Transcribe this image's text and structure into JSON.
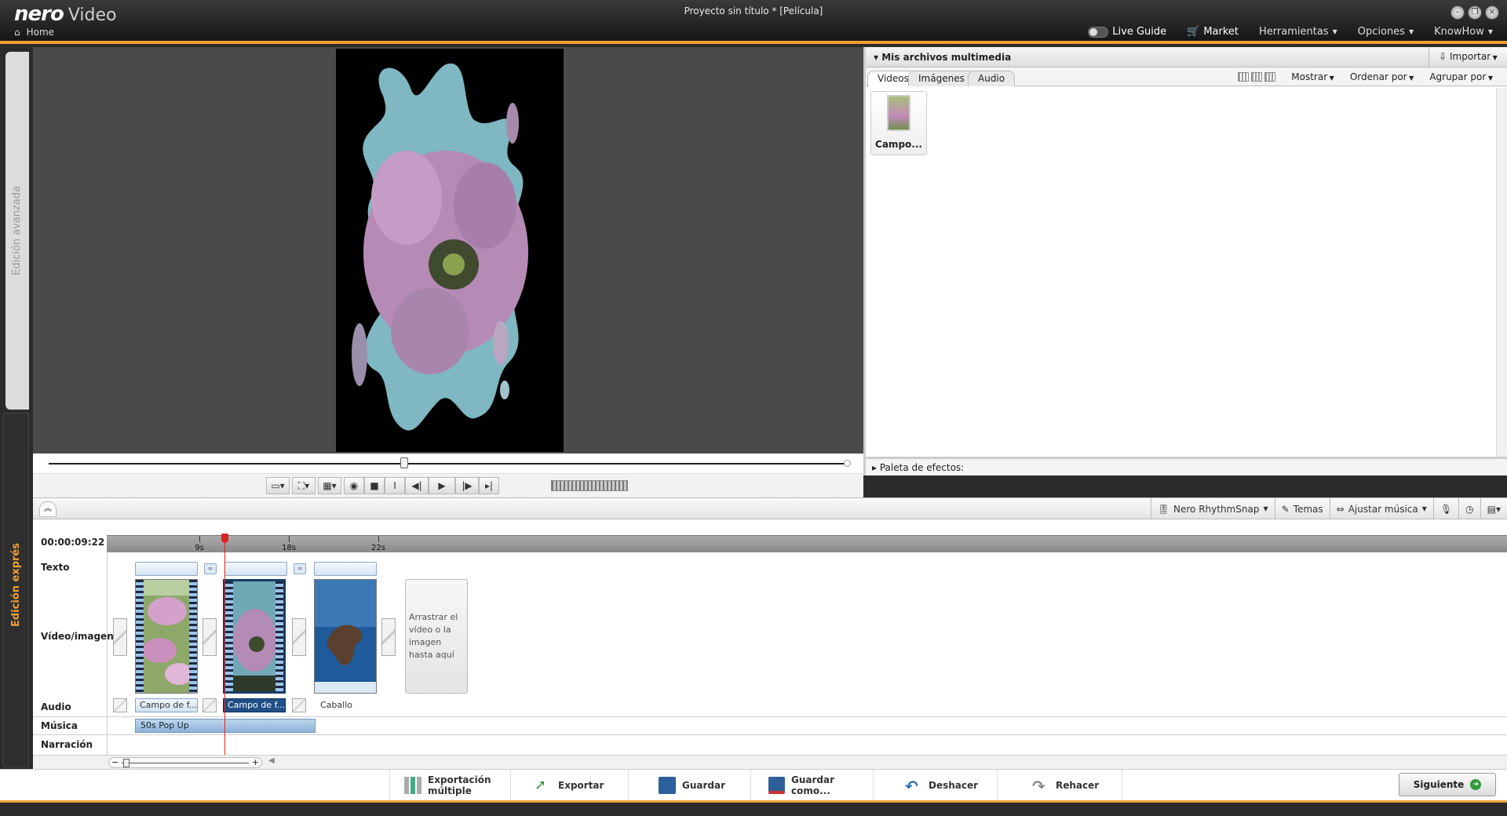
{
  "app": {
    "logo": "nero",
    "logo_sub": "Video",
    "doc_title": "Proyecto sin título * [Película]",
    "home": "Home"
  },
  "menu": {
    "live_guide": "Live Guide",
    "market": "Market",
    "herramientas": "Herramientas",
    "opciones": "Opciones",
    "knowhow": "KnowHow"
  },
  "side_tabs": {
    "advanced": "Edición avanzada",
    "express": "Edición exprés"
  },
  "library": {
    "title": "Mis archivos multimedia",
    "import": "Importar",
    "tabs": [
      "Videos",
      "Imágenes",
      "Audio"
    ],
    "mostrar": "Mostrar",
    "ordenar": "Ordenar por",
    "agrupar": "Agrupar por",
    "items": [
      {
        "label": "Campo..."
      }
    ],
    "effects": "Paleta de efectos:"
  },
  "timeline_toolbar": {
    "rhythmsnap": "Nero RhythmSnap",
    "temas": "Temas",
    "ajustar": "Ajustar música"
  },
  "timeline": {
    "timecode": "00:00:09:22",
    "ticks": [
      "9s",
      "18s",
      "22s"
    ],
    "tracks": {
      "texto": "Texto",
      "video": "Vídeo/imagen",
      "audio": "Audio",
      "musica": "Música",
      "narracion": "Narración"
    },
    "drop_hint": "Arrastrar el vídeo o la imagen hasta aquí",
    "audio_clips": [
      "Campo de f...",
      "Campo de f...",
      "Caballo"
    ],
    "music_clip": "50s Pop Up"
  },
  "bottom": {
    "export_multi_1": "Exportación",
    "export_multi_2": "múltiple",
    "exportar": "Exportar",
    "guardar": "Guardar",
    "guardar_como": "Guardar como...",
    "deshacer": "Deshacer",
    "rehacer": "Rehacer",
    "siguiente": "Siguiente"
  },
  "colors": {
    "accent": "#f0a030",
    "selection": "#1f4f86",
    "playhead": "#dd2222"
  }
}
